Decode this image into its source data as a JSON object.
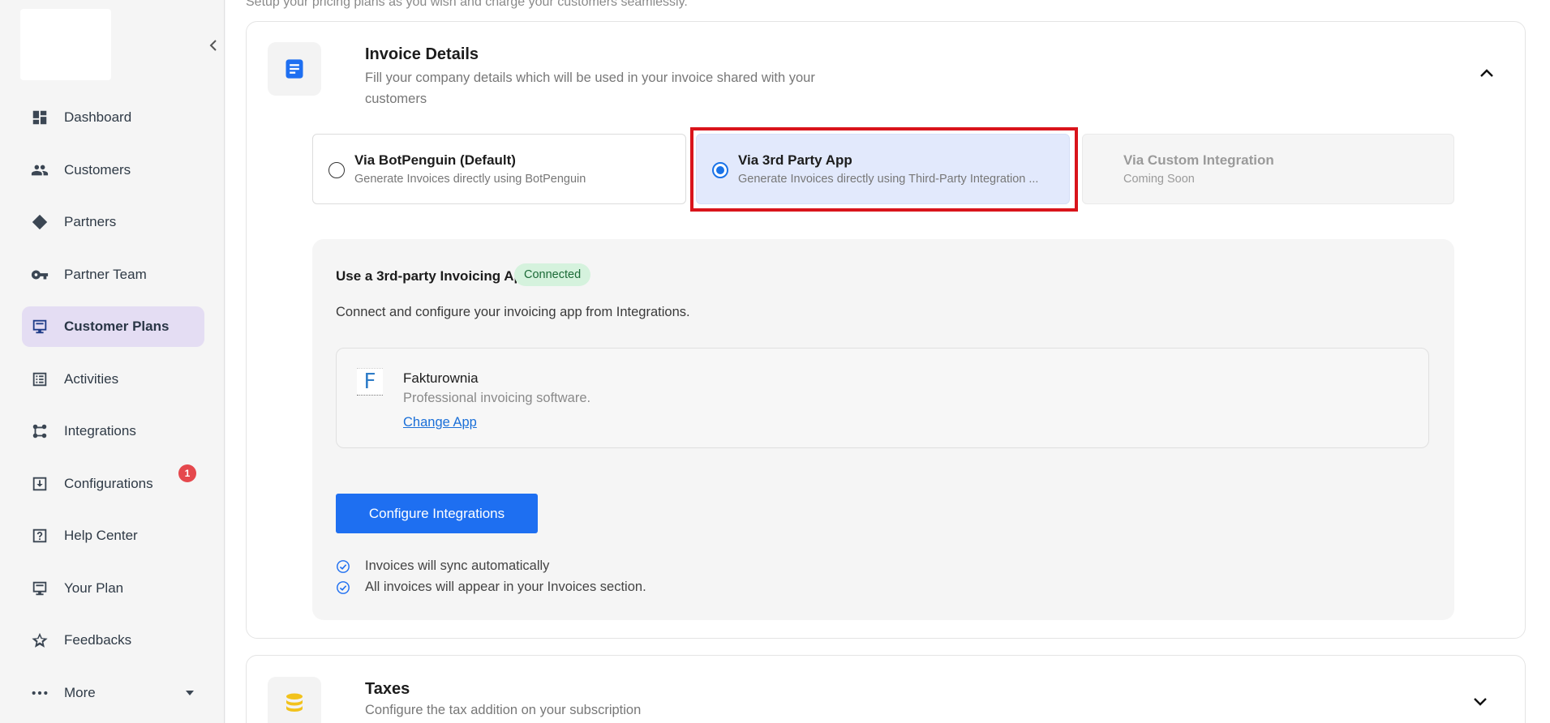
{
  "sidebar": {
    "items": [
      {
        "label": "Dashboard",
        "icon": "dashboard-icon"
      },
      {
        "label": "Customers",
        "icon": "customers-icon"
      },
      {
        "label": "Partners",
        "icon": "partners-icon"
      },
      {
        "label": "Partner Team",
        "icon": "key-icon"
      },
      {
        "label": "Customer Plans",
        "icon": "plans-icon",
        "active": true
      },
      {
        "label": "Activities",
        "icon": "activities-icon"
      },
      {
        "label": "Integrations",
        "icon": "integrations-icon"
      },
      {
        "label": "Configurations",
        "icon": "configurations-icon",
        "badge": "1"
      },
      {
        "label": "Help Center",
        "icon": "help-icon"
      },
      {
        "label": "Your Plan",
        "icon": "your-plan-icon"
      },
      {
        "label": "Feedbacks",
        "icon": "star-icon"
      },
      {
        "label": "More",
        "icon": "more-icon"
      }
    ]
  },
  "main": {
    "top_subtitle": "Setup your pricing plans as you wish and charge your customers seamlessly.",
    "invoice": {
      "title": "Invoice Details",
      "description": "Fill your company details which will be used in your invoice shared with your customers",
      "options": [
        {
          "title": "Via BotPenguin (Default)",
          "subtitle": "Generate Invoices directly using BotPenguin"
        },
        {
          "title": "Via 3rd Party App",
          "subtitle": "Generate Invoices directly using Third-Party Integration ..."
        },
        {
          "title": "Via Custom Integration",
          "subtitle": "Coming Soon"
        }
      ],
      "panel": {
        "title": "Use a 3rd-party Invoicing App",
        "status": "Connected",
        "description": "Connect and configure your invoicing app from Integrations.",
        "app": {
          "logo_letter": "F",
          "name": "Fakturownia",
          "description": "Professional invoicing software.",
          "link": "Change App"
        },
        "button": "Configure Integrations",
        "checks": [
          "Invoices will sync automatically",
          "All invoices will appear in your Invoices section."
        ]
      }
    },
    "taxes": {
      "title": "Taxes",
      "description": "Configure the tax addition on your subscription"
    }
  },
  "colors": {
    "accent": "#1e6ff1",
    "active_nav": "#e4ddf3",
    "highlight_border": "#d9141b",
    "connected_bg": "#d5f2dd",
    "badge": "#e5484d"
  }
}
